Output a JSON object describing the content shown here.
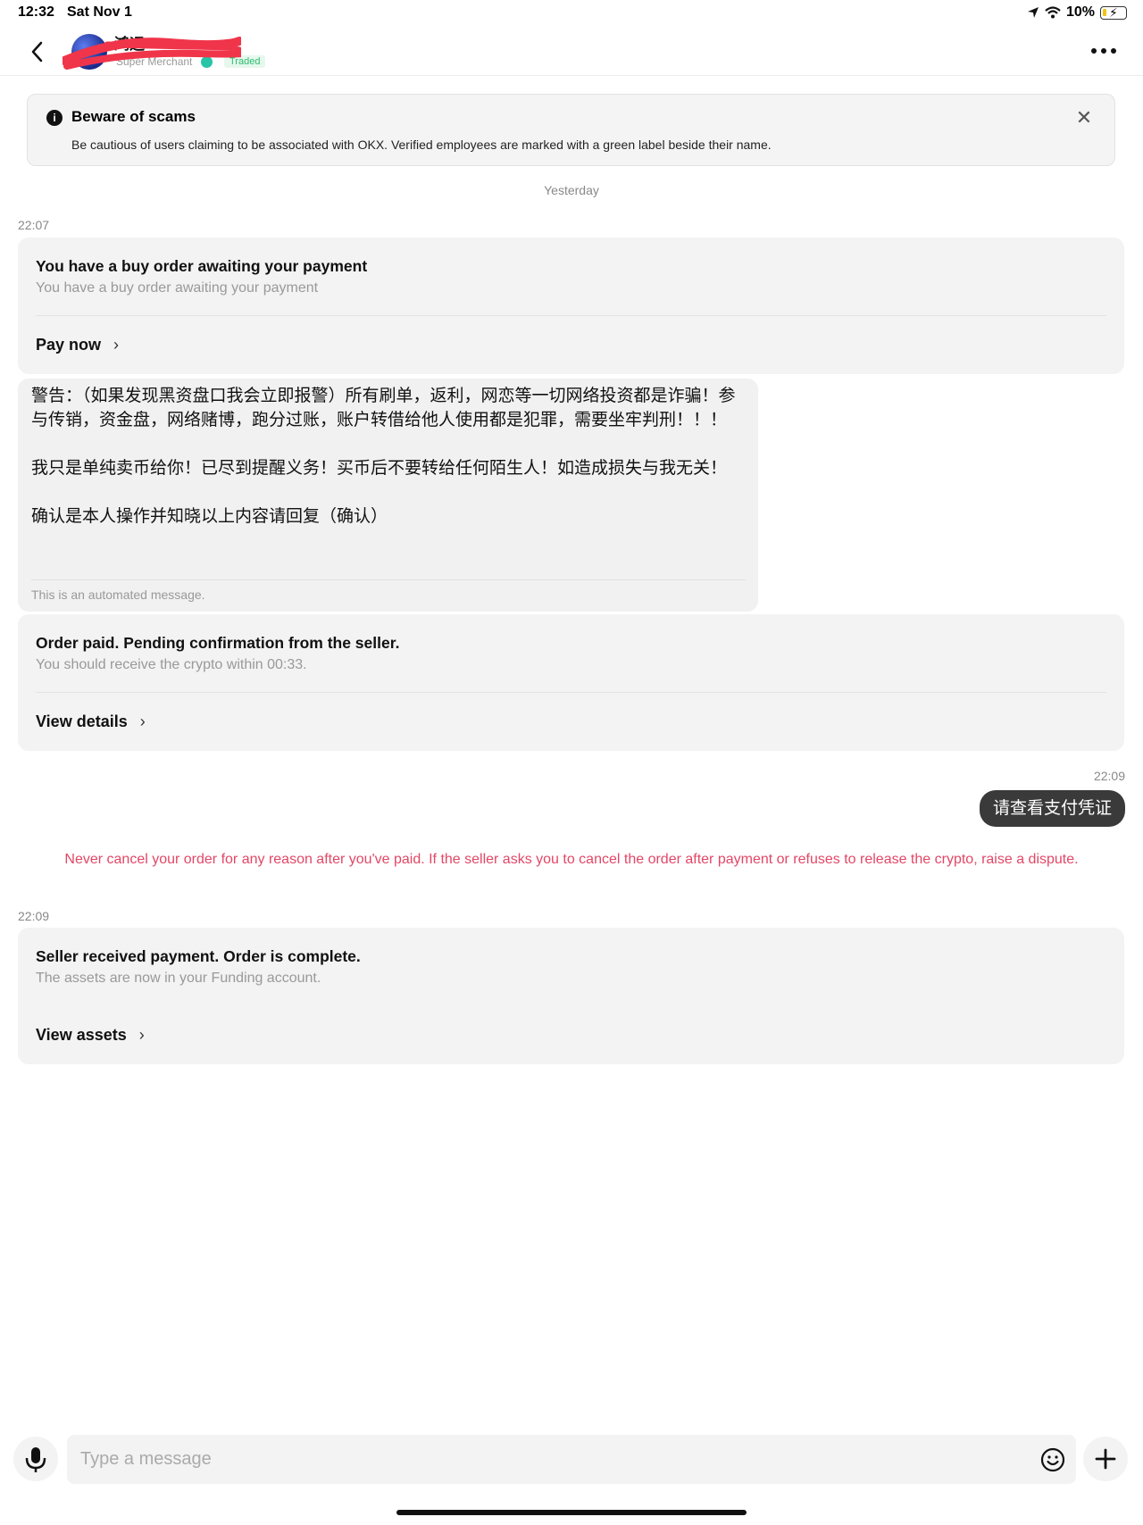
{
  "status_bar": {
    "time": "12:32",
    "date": "Sat Nov 1",
    "battery": "10%",
    "icons": [
      "location-icon",
      "wifi-icon",
      "battery-charging-icon"
    ]
  },
  "header": {
    "merchant_name": "鸿运",
    "tier": "Super Merchant",
    "badge": "Traded"
  },
  "scam_banner": {
    "title": "Beware of scams",
    "body": "Be cautious of users claiming to be associated with OKX. Verified employees are marked with a green label beside their name."
  },
  "date_separator": "Yesterday",
  "messages": {
    "ts1": "22:07",
    "card1": {
      "title": "You have a buy order awaiting your payment",
      "subtitle": "You have a buy order awaiting your payment",
      "link": "Pay now"
    },
    "auto": {
      "text": "警告：（如果发现黑资盘口我会立即报警）所有刷单，返利，网恋等一切网络投资都是诈骗！参与传销，资金盘，网络赌博，跑分过账，账户转借给他人使用都是犯罪，需要坐牢判刑！！！\n\n我只是单纯卖币给你！已尽到提醒义务！买币后不要转给任何陌生人！如造成损失与我无关！\n\n确认是本人操作并知晓以上内容请回复（确认）",
      "note": "This is an automated message."
    },
    "card2": {
      "title": "Order paid. Pending confirmation from the seller.",
      "subtitle": "You should receive the crypto within 00:33.",
      "link": "View details"
    },
    "ts2": "22:09",
    "outgoing": "请查看支付凭证",
    "warning": "Never cancel your order for any reason after you've paid. If the seller asks you to cancel the order after payment or refuses to release the crypto, raise a dispute.",
    "ts3": "22:09",
    "card3": {
      "title": "Seller received payment. Order is complete.",
      "subtitle": "The assets are now in your Funding account.",
      "link": "View assets"
    }
  },
  "composer": {
    "placeholder": "Type a message"
  },
  "colors": {
    "warning": "#e24766",
    "card_bg": "#f3f3f3",
    "bubble_bg": "#3a3a3a",
    "verified": "#27c4a8",
    "traded": "#2dbd6e"
  }
}
